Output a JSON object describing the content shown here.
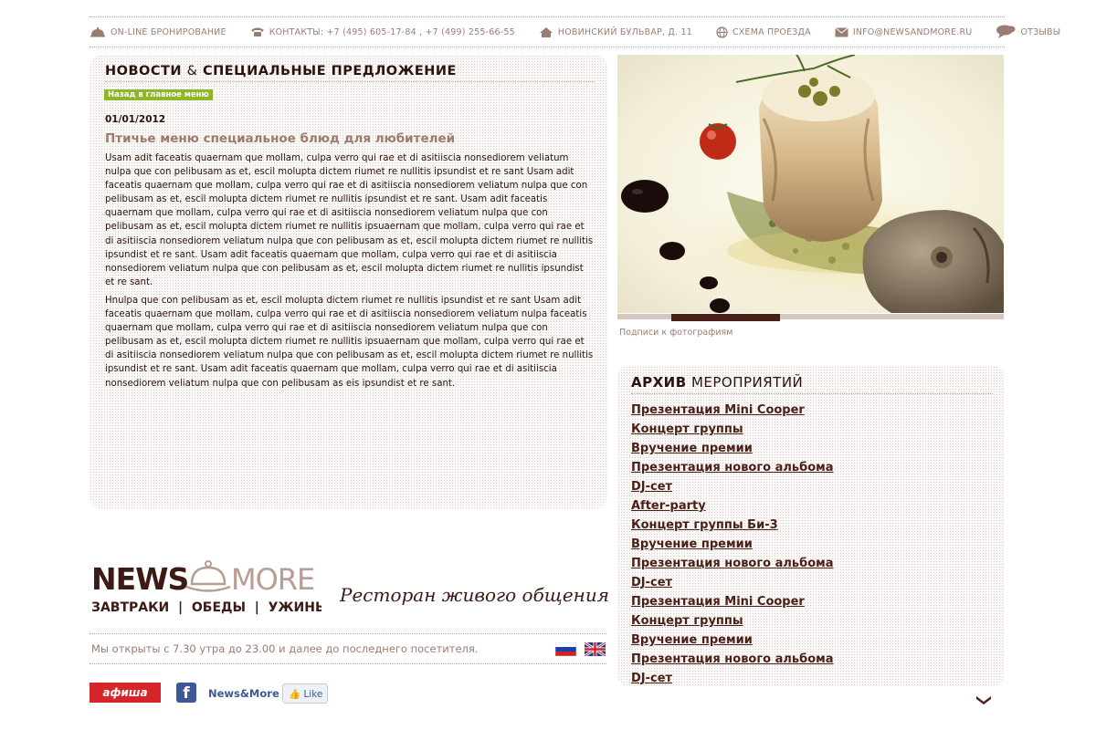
{
  "topnav": [
    {
      "label": "ON-LINE БРОНИРОВАНИЕ",
      "icon": "cloche-icon"
    },
    {
      "label": "КОНТАКТЫ: +7 (495) 605-17-84 , +7 (499) 255-66-55",
      "icon": "phone-icon"
    },
    {
      "label": "НОВИНСКИЙ БУЛЬВАР, Д. 11",
      "icon": "home-icon"
    },
    {
      "label": "СХЕМА ПРОЕЗДА",
      "icon": "globe-icon"
    },
    {
      "label": "INFO@NEWSANDMORE.RU",
      "icon": "mail-icon"
    },
    {
      "label": "ОТЗЫВЫ",
      "icon": "speech-bubble-icon"
    }
  ],
  "news": {
    "title_part1": "НОВОСТИ",
    "title_amp": "&",
    "title_part2": "СПЕЦИАЛЬНЫЕ ПРЕДЛОЖЕНИЕ",
    "back_label": "Назад в главное меню",
    "date": "01/01/2012",
    "headline": "Птичье меню специальное блюд для любителей",
    "paragraph1": "Usam adit faceatis quaernam que mollam, culpa verro qui rae et di asitiiscia nonsediorem veliatum nulpa que con pelibusam as et, escil molupta dictem riumet re nullitis ipsundist et re sant Usam adit faceatis quaernam que mollam, culpa verro qui rae et di asitiiscia nonsediorem veliatum nulpa que con pelibusam as et, escil molupta dictem riumet re nullitis ipsundist et re sant. Usam adit faceatis quaernam que mollam, culpa verro qui rae et di asitiiscia nonsediorem veliatum nulpa que con pelibusam as et, escil molupta dictem riumet re nullitis ipsuaernam que mollam, culpa verro qui rae et di asitiiscia nonsediorem veliatum nulpa que con pelibusam as et, escil molupta dictem riumet re nullitis ipsundist et re sant. Usam adit faceatis quaernam que mollam, culpa verro qui rae et di asitiiscia nonsediorem veliatum nulpa que con pelibusam as et, escil molupta dictem riumet re nullitis ipsundist et re sant.",
    "paragraph2": "Hnulpa que con pelibusam as et, escil molupta dictem riumet re nullitis ipsundist et re sant Usam adit faceatis quaernam que mollam, culpa verro qui rae et di asitiiscia nonsediorem veliatum nulpa faceatis quaernam que mollam, culpa verro qui rae et di asitiiscia nonsediorem veliatum nulpa que con pelibusam as et, escil molupta dictem riumet re nullitis ipsuaernam que mollam, culpa verro qui rae et di asitiiscia nonsediorem veliatum nulpa que con pelibusam as et, escil molupta dictem riumet re nullitis ipsundist et re sant. Usam adit faceatis quaernam que mollam, culpa verro qui rae et di asitiiscia nonsediorem veliatum nulpa que con pelibusam as eis ipsundist et re sant."
  },
  "photo": {
    "caption": "Подписи к фотографиям",
    "slider_total": 4,
    "slider_active": 2
  },
  "archive": {
    "title_bold": "АРХИВ",
    "title_rest": "МЕРОПРИЯТИЙ",
    "items": [
      "Презентация Mini Cooper",
      "Концерт группы",
      "Вручение премии",
      "Презентация нового альбома",
      "DJ-сет",
      "After-party",
      "Концерт группы Би-3",
      "Вручение премии",
      "Презентация нового альбома",
      "DJ-сет",
      "Презентация Mini Cooper",
      "Концерт группы",
      "Вручение премии",
      "Презентация нового альбома",
      "DJ-сет"
    ]
  },
  "footer": {
    "logo_word1": "NEWS",
    "logo_word2": "MORE",
    "logo_sub": "ЗАВТРАКИ  |  ОБЕДЫ  |  УЖИНЫ",
    "tagline": "Ресторан живого общения",
    "hours": "Мы открыты с 7.30 утра до 23.00 и далее до последнего посетителя.",
    "afisha": "афиша",
    "fb_letter": "f",
    "fb_name": "News&More",
    "like": "Like"
  },
  "colors": {
    "brand_dark": "#4a1f17",
    "brand_muted": "#9a7d72",
    "green": "#8db62a",
    "facebook": "#3b5998",
    "afisha_red": "#d6242b"
  }
}
